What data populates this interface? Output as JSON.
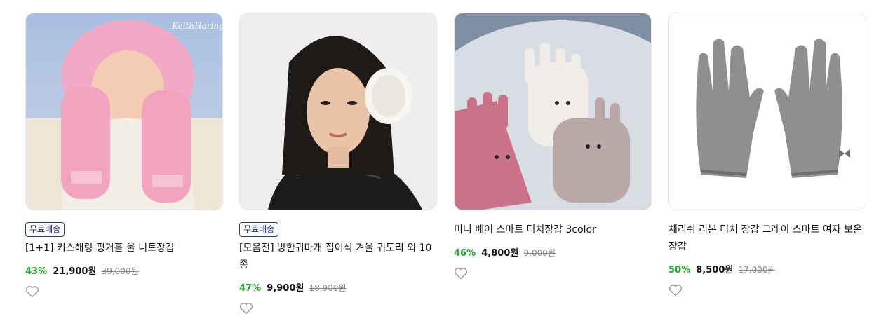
{
  "products": [
    {
      "badge": "무료배송",
      "title": "[1+1] 키스해링 핑거홀 울 니트장갑",
      "discount": "43%",
      "price": "21,900원",
      "original": "39,000원",
      "image_watermark": "KeithHaring™"
    },
    {
      "badge": "무료배송",
      "title": "[모음전] 방한귀마개 접이식 겨울 귀도리 외 10종",
      "discount": "47%",
      "price": "9,900원",
      "original": "18,900원"
    },
    {
      "title": "미니 베어 스마트 터치장갑 3color",
      "discount": "46%",
      "price": "4,800원",
      "original": "9,000원"
    },
    {
      "title": "체리쉬 리본 터치 장갑 그레이 스마트 여자 보온장갑",
      "discount": "50%",
      "price": "8,500원",
      "original": "17,000원"
    }
  ],
  "colors": {
    "discount": "#22a52e",
    "badge_border": "#2a3a85",
    "badge_text": "#1c2d73"
  },
  "icons": {
    "wishlist": "heart-outline-icon"
  }
}
